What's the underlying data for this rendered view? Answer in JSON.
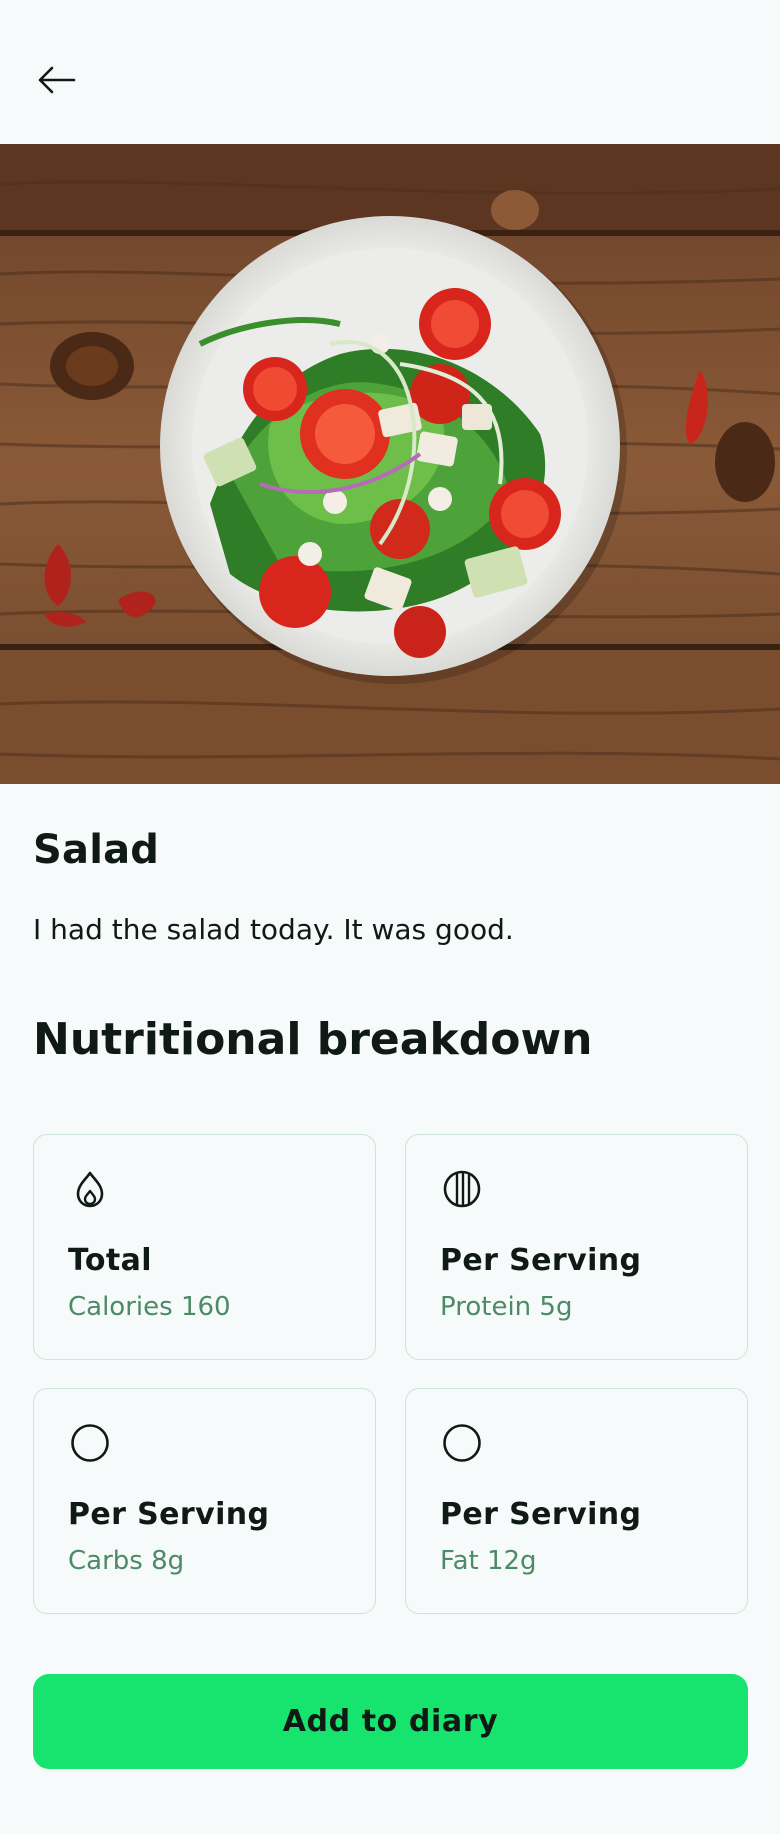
{
  "header": {
    "back_icon": "arrow-left-icon"
  },
  "hero": {
    "image_alt": "salad-photo"
  },
  "meal": {
    "title": "Salad",
    "description": "I had the salad today. It was good."
  },
  "nutrition": {
    "title": "Nutritional breakdown",
    "cards": [
      {
        "icon": "flame-icon",
        "label": "Total",
        "value": "Calories 160"
      },
      {
        "icon": "striped-circle-icon",
        "label": "Per Serving",
        "value": "Protein 5g"
      },
      {
        "icon": "circle-icon",
        "label": "Per Serving",
        "value": "Carbs 8g"
      },
      {
        "icon": "circle-icon",
        "label": "Per Serving",
        "value": "Fat 12g"
      }
    ]
  },
  "actions": {
    "add_label": "Add to diary"
  },
  "colors": {
    "accent": "#17e46f",
    "value_text": "#4d8a66",
    "card_border": "#cfe3d6",
    "background": "#f6fafa"
  }
}
